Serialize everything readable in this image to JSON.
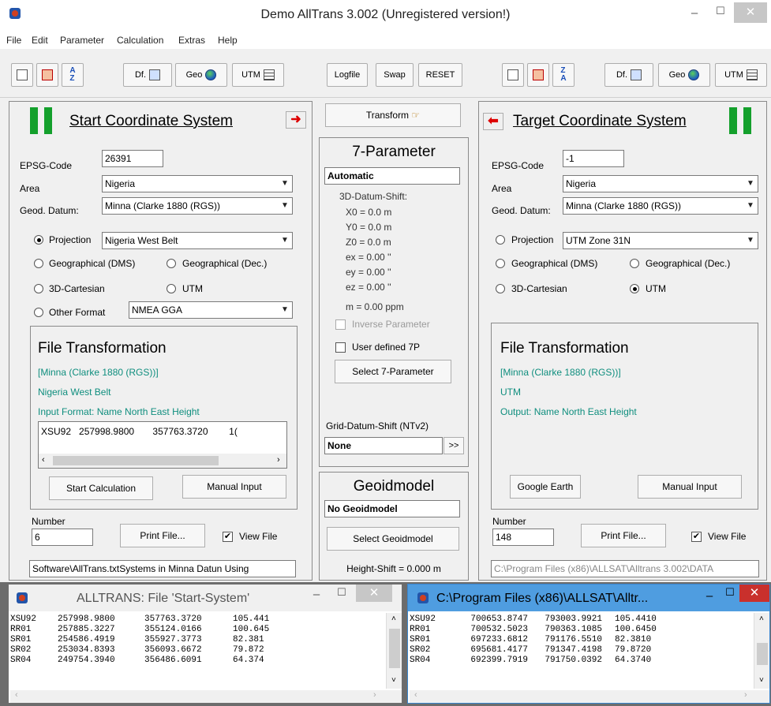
{
  "window": {
    "title": "Demo AllTrans 3.002 (Unregistered version!)",
    "min": "–",
    "max": "☐",
    "close": "✕"
  },
  "menu": [
    "File",
    "Edit",
    "Parameter",
    "Calculation",
    "Extras",
    "Help"
  ],
  "toolbar": {
    "left": {
      "df": "Df.",
      "geo": "Geo",
      "utm": "UTM"
    },
    "mid": {
      "logfile": "Logfile",
      "swap": "Swap",
      "reset": "RESET"
    },
    "right": {
      "df": "Df.",
      "geo": "Geo",
      "utm": "UTM"
    }
  },
  "start": {
    "heading": "Start Coordinate System",
    "epsg_label": "EPSG-Code",
    "epsg_value": "26391",
    "area_label": "Area",
    "area_value": "Nigeria",
    "datum_label": "Geod. Datum:",
    "datum_value": "Minna (Clarke 1880 (RGS))",
    "projection_label": "Projection",
    "projection_value": "Nigeria West Belt",
    "geo_dms": "Geographical (DMS)",
    "geo_dec": "Geographical (Dec.)",
    "cartesian": "3D-Cartesian",
    "utm": "UTM",
    "other_format": "Other Format",
    "other_format_value": "NMEA GGA",
    "selected": "projection",
    "file": {
      "title": "File Transformation",
      "line1": "[Minna (Clarke 1880 (RGS))]",
      "line2": "Nigeria West Belt",
      "line3": "Input Format: Name North East Height",
      "preview": "XSU92   257998.9800       357763.3720        1(",
      "calc_button": "Start Calculation",
      "manual_button": "Manual Input"
    },
    "number_label": "Number",
    "number_value": "6",
    "print_button": "Print File...",
    "view_file": "View File",
    "path": "Software\\AllTrans.txtSystems in Minna Datun Using"
  },
  "middle": {
    "transform": "Transform",
    "seven_title": "7-Parameter",
    "mode": "Automatic",
    "shift_label": "3D-Datum-Shift:",
    "params": [
      "X0 =   0.0 m",
      "Y0 =   0.0 m",
      "Z0 =   0.0 m",
      "ex =  0.00 ''",
      "ey =  0.00 ''",
      "ez =  0.00 ''",
      "m =  0.00 ppm"
    ],
    "inverse": "Inverse Parameter",
    "user_defined": "User defined 7P",
    "select_7p": "Select 7-Parameter",
    "grid_label": "Grid-Datum-Shift (NTv2)",
    "grid_value": "None",
    "grid_btn": ">>",
    "geoid_title": "Geoidmodel",
    "geoid_value": "No Geoidmodel",
    "select_geoid": "Select Geoidmodel",
    "height_shift": "Height-Shift  =  0.000 m"
  },
  "target": {
    "heading": "Target Coordinate System",
    "epsg_label": "EPSG-Code",
    "epsg_value": "-1",
    "area_label": "Area",
    "area_value": "Nigeria",
    "datum_label": "Geod. Datum:",
    "datum_value": "Minna (Clarke 1880 (RGS))",
    "projection_label": "Projection",
    "projection_value": "UTM Zone 31N",
    "geo_dms": "Geographical (DMS)",
    "geo_dec": "Geographical (Dec.)",
    "cartesian": "3D-Cartesian",
    "utm": "UTM",
    "selected": "utm",
    "file": {
      "title": "File Transformation",
      "line1": "[Minna (Clarke 1880 (RGS))]",
      "line2": "UTM",
      "line3": "Output: Name North East Height",
      "ge_button": "Google Earth",
      "manual_button": "Manual Input"
    },
    "number_label": "Number",
    "number_value": "148",
    "print_button": "Print File...",
    "view_file": "View File",
    "path": "C:\\Program Files (x86)\\ALLSAT\\Alltrans 3.002\\DATA"
  },
  "subwin_left": {
    "title": "ALLTRANS: File 'Start-System'",
    "rows": [
      [
        "XSU92",
        "257998.9800",
        "357763.3720",
        "105.441"
      ],
      [
        "RR01",
        "257885.3227",
        "355124.0166",
        "100.645"
      ],
      [
        "SR01",
        "254586.4919",
        "355927.3773",
        "82.381"
      ],
      [
        "SR02",
        "253034.8393",
        "356093.6672",
        "79.872"
      ],
      [
        "SR04",
        "249754.3940",
        "356486.6091",
        "64.374"
      ]
    ]
  },
  "subwin_right": {
    "title": "C:\\Program Files (x86)\\ALLSAT\\Alltr...",
    "rows": [
      [
        "XSU92",
        "700653.8747",
        "793003.9921",
        "105.4410"
      ],
      [
        "RR01",
        "700532.5023",
        "790363.1085",
        "100.6450"
      ],
      [
        "SR01",
        "697233.6812",
        "791176.5510",
        "82.3810"
      ],
      [
        "SR02",
        "695681.4177",
        "791347.4198",
        "79.8720"
      ],
      [
        "SR04",
        "692399.7919",
        "791750.0392",
        "64.3740"
      ]
    ]
  },
  "colors": {
    "flag_green": "#14a02c",
    "teal_text": "#0f8e7e",
    "active_title": "#4f9de0"
  }
}
